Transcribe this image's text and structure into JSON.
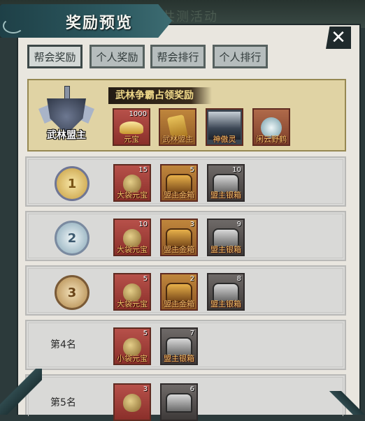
{
  "background": {
    "ghost_text": "共测活动"
  },
  "header": {
    "title": "奖励预览",
    "close_icon": "close-icon"
  },
  "tabs": [
    {
      "label": "帮会奖励",
      "active": true
    },
    {
      "label": "个人奖励",
      "active": false
    },
    {
      "label": "帮会排行",
      "active": false
    },
    {
      "label": "个人排行",
      "active": false
    }
  ],
  "hero": {
    "emblem_label": "武林盟主",
    "title": "武林争霸占领奖励",
    "items": [
      {
        "name": "元宝",
        "count": "1000",
        "icon": "gold-ingot-icon"
      },
      {
        "name": "武林盟主",
        "count": "",
        "icon": "title-token-icon"
      },
      {
        "name": "神傲灵",
        "count": "",
        "icon": "portrait-icon"
      },
      {
        "name": "闲云野鹤",
        "count": "",
        "icon": "crane-icon"
      }
    ]
  },
  "ranks": [
    {
      "rank": "1",
      "label": "",
      "medal": "gold",
      "items": [
        {
          "name": "大袋元宝",
          "count": "15",
          "icon": "money-bag-icon"
        },
        {
          "name": "盟主金箱",
          "count": "5",
          "icon": "gold-chest-icon"
        },
        {
          "name": "盟主银箱",
          "count": "10",
          "icon": "silver-chest-icon"
        }
      ]
    },
    {
      "rank": "2",
      "label": "",
      "medal": "silver",
      "items": [
        {
          "name": "大袋元宝",
          "count": "10",
          "icon": "money-bag-icon"
        },
        {
          "name": "盟主金箱",
          "count": "3",
          "icon": "gold-chest-icon"
        },
        {
          "name": "盟主银箱",
          "count": "9",
          "icon": "silver-chest-icon"
        }
      ]
    },
    {
      "rank": "3",
      "label": "",
      "medal": "bronze",
      "items": [
        {
          "name": "大袋元宝",
          "count": "5",
          "icon": "money-bag-icon"
        },
        {
          "name": "盟主金箱",
          "count": "2",
          "icon": "gold-chest-icon"
        },
        {
          "name": "盟主银箱",
          "count": "8",
          "icon": "silver-chest-icon"
        }
      ]
    },
    {
      "rank": "4",
      "label": "第4名",
      "medal": "",
      "items": [
        {
          "name": "小袋元宝",
          "count": "5",
          "icon": "money-bag-icon"
        },
        {
          "name": "盟主银箱",
          "count": "7",
          "icon": "silver-chest-icon"
        }
      ]
    },
    {
      "rank": "5",
      "label": "第5名",
      "medal": "",
      "items": [
        {
          "name": "",
          "count": "3",
          "icon": "money-bag-icon"
        },
        {
          "name": "",
          "count": "6",
          "icon": "silver-chest-icon"
        }
      ]
    }
  ]
}
